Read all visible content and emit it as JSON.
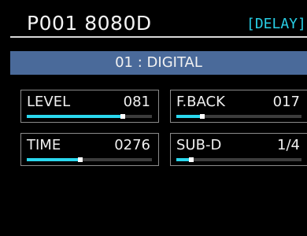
{
  "header": {
    "patch_name": "P001 8080D",
    "effect_type": "[DELAY]"
  },
  "variation": {
    "label": "01 : DIGITAL"
  },
  "params": [
    {
      "name": "LEVEL",
      "value": "081",
      "level": 0.77
    },
    {
      "name": "F.BACK",
      "value": "017",
      "level": 0.21
    },
    {
      "name": "TIME",
      "value": "0276",
      "level": 0.43
    },
    {
      "name": "SUB-D",
      "value": "1/4",
      "level": 0.12
    }
  ],
  "colors": {
    "accent": "#2ad8ee",
    "type_text": "#28cfe6",
    "variation_bg": "#4a6a9a",
    "background": "#000000"
  }
}
